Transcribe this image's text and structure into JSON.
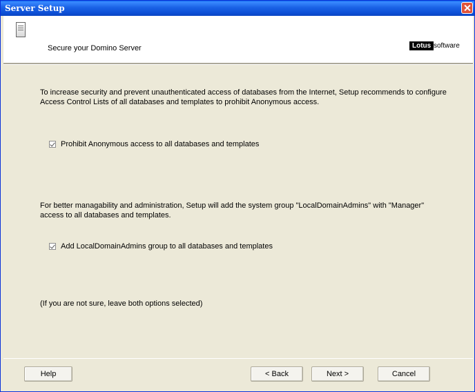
{
  "window": {
    "title": "Server Setup"
  },
  "header": {
    "title": "Secure your Domino Server",
    "brand_primary": "Lotus",
    "brand_secondary": "software"
  },
  "body": {
    "intro_text": "To increase security and prevent unauthenticated access of databases from the Internet, Setup recommends to configure Access Control Lists of all databases and templates to prohibit Anonymous access.",
    "checkbox1_label": "Prohibit Anonymous access to all databases and templates",
    "checkbox1_checked": true,
    "manage_text": "For better managability and administration, Setup will add the system group \"LocalDomainAdmins\" with \"Manager\" access to all databases and templates.",
    "checkbox2_label": "Add LocalDomainAdmins group to all databases and templates",
    "checkbox2_checked": true,
    "note_text": "(If you are not sure, leave both options selected)"
  },
  "buttons": {
    "help": "Help",
    "back": "< Back",
    "next": "Next >",
    "cancel": "Cancel"
  },
  "icons": {
    "header_icon": "server-document-icon",
    "close": "close-icon"
  },
  "colors": {
    "titlebar": "#0d4fd6",
    "close_button": "#e0533a",
    "dialog_background": "#ece9d8"
  }
}
